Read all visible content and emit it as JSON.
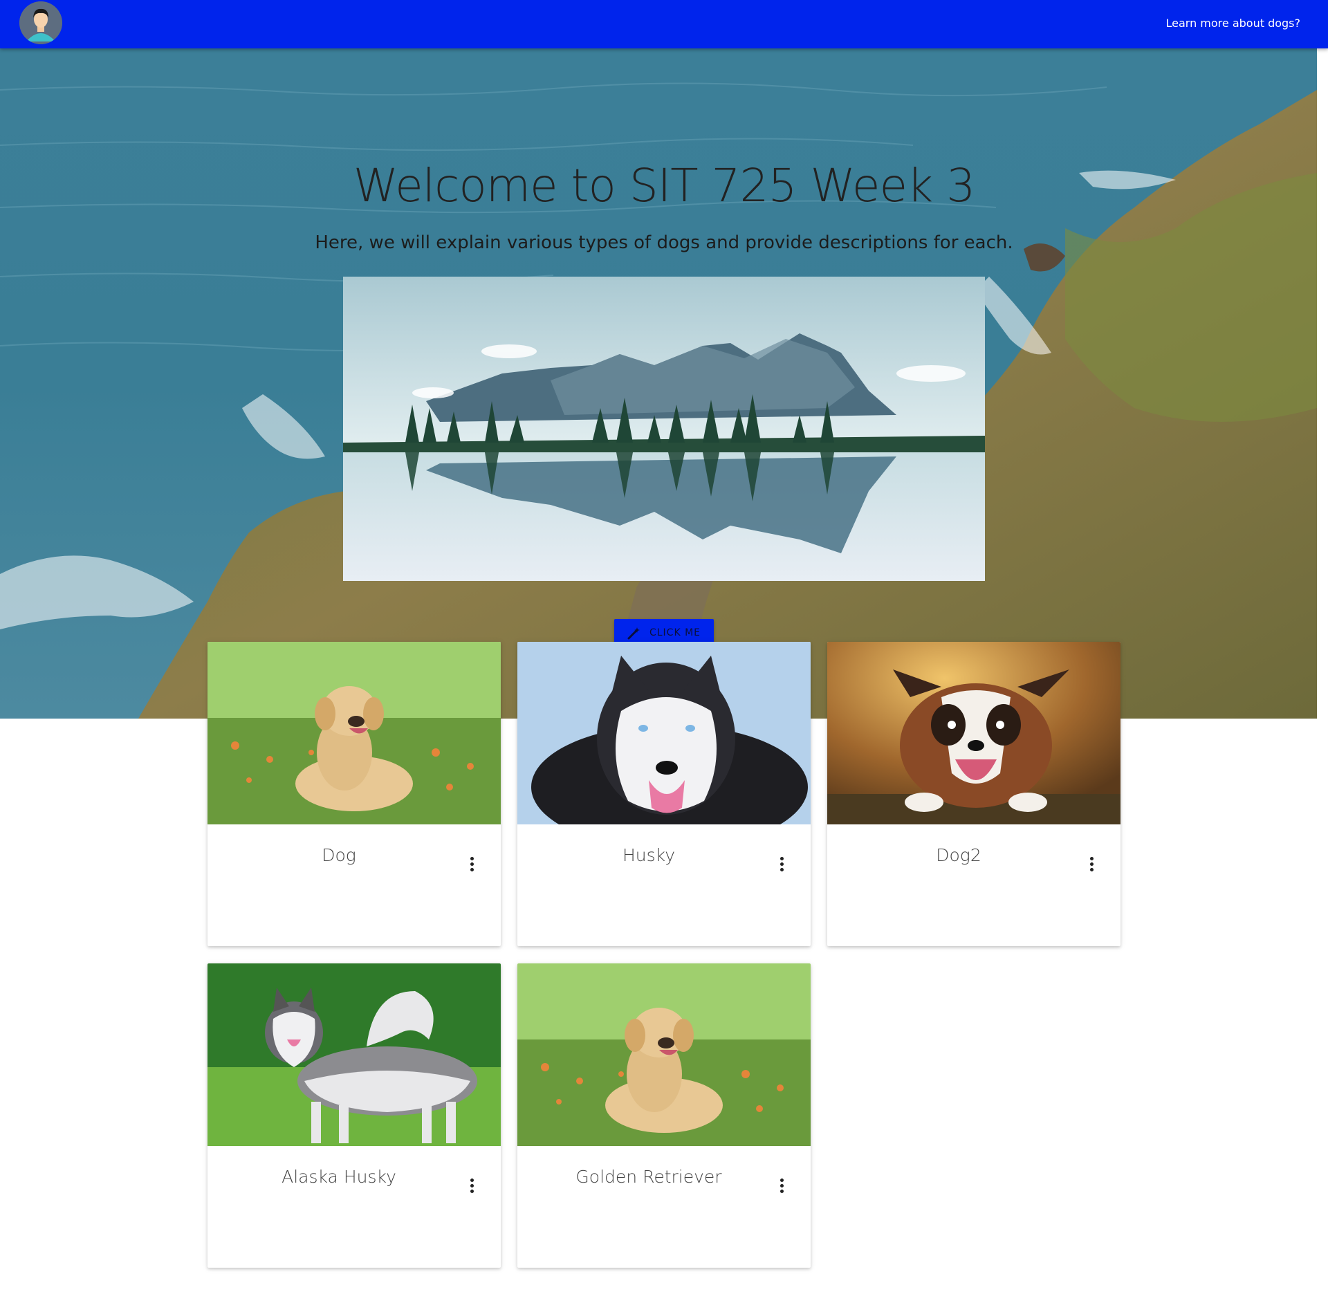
{
  "navbar": {
    "avatar_icon": "user-avatar-icon",
    "link_label": "Learn more about dogs?",
    "background_color": "#0024ec"
  },
  "hero": {
    "title": "Welcome to SIT 725 Week 3",
    "subtitle": "Here, we will explain various types of dogs and provide descriptions for each.",
    "image": "mountain-lake-reflection-image",
    "background": "coastal-cliff-ocean-image",
    "button": {
      "label": "CLICK ME",
      "icon": "magic-wand-icon",
      "color": "#0024ec"
    }
  },
  "cards": [
    {
      "title": "Dog",
      "image": "golden-puppy-on-grass-image",
      "menu_icon": "more-vert-icon"
    },
    {
      "title": "Husky",
      "image": "husky-closeup-image",
      "menu_icon": "more-vert-icon"
    },
    {
      "title": "Dog2",
      "image": "border-collie-image",
      "menu_icon": "more-vert-icon"
    },
    {
      "title": "Alaska Husky",
      "image": "alaskan-malamute-on-grass-image",
      "menu_icon": "more-vert-icon"
    },
    {
      "title": "Golden Retriever",
      "image": "golden-puppy-on-grass-image",
      "menu_icon": "more-vert-icon"
    }
  ]
}
